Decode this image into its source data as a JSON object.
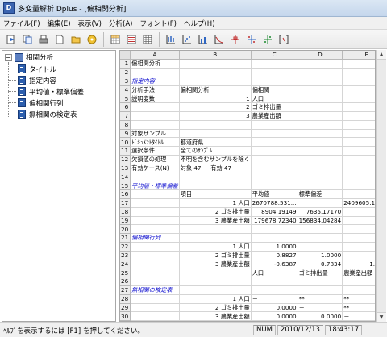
{
  "window": {
    "title": "多変量解析 Dplus - [偏相関分析]",
    "icon_label": "D"
  },
  "menu": [
    {
      "label": "ファイル(F)"
    },
    {
      "label": "編集(E)"
    },
    {
      "label": "表示(V)"
    },
    {
      "label": "分析(A)"
    },
    {
      "label": "フォント(F)"
    },
    {
      "label": "ヘルプ(H)"
    }
  ],
  "toolbar": {
    "icons": [
      "import-icon",
      "copy-icon",
      "print-icon",
      "new-icon",
      "folder-icon",
      "disk-icon",
      "grid-icon",
      "list-icon",
      "table-icon",
      "regression-icon",
      "scatter-icon",
      "bar-chart-icon",
      "axis-chart-icon",
      "boxplot-icon",
      "dots-icon",
      "tree-icon",
      "bracket-icon"
    ]
  },
  "tree": {
    "root": "相関分析",
    "items": [
      "タイトル",
      "指定内容",
      "平均値・標準偏差",
      "偏相関行列",
      "無相関の検定表"
    ]
  },
  "sheet": {
    "columns": [
      "A",
      "B",
      "C",
      "D",
      "E"
    ],
    "rows": [
      {
        "n": "1",
        "c": [
          "偏相関分析",
          "",
          "",
          "",
          ""
        ]
      },
      {
        "n": "2",
        "c": [
          "",
          "",
          "",
          "",
          ""
        ]
      },
      {
        "n": "3",
        "c": [
          "指定内容",
          "",
          "",
          "",
          ""
        ],
        "section": true
      },
      {
        "n": "4",
        "c": [
          "分析手法",
          "偏相関分析",
          "偏相関",
          "",
          ""
        ]
      },
      {
        "n": "5",
        "c": [
          "説明変数",
          "1",
          "人口",
          "",
          ""
        ]
      },
      {
        "n": "6",
        "c": [
          "",
          "2",
          "ゴミ排出量",
          "",
          ""
        ]
      },
      {
        "n": "7",
        "c": [
          "",
          "3",
          "農業産出額",
          "",
          ""
        ]
      },
      {
        "n": "8",
        "c": [
          "",
          "",
          "",
          "",
          ""
        ]
      },
      {
        "n": "9",
        "c": [
          "対象サンプル",
          "",
          "",
          "",
          ""
        ]
      },
      {
        "n": "10",
        "c": [
          "ﾄﾞｷｭﾒﾝﾄﾀｲﾄﾙ",
          "都道府県",
          "",
          "",
          ""
        ]
      },
      {
        "n": "11",
        "c": [
          "選択条件",
          "全てのｻﾝﾌﾟﾙ",
          "",
          "",
          ""
        ]
      },
      {
        "n": "12",
        "c": [
          "欠損値の処理",
          "不明を含むサンプルを除く",
          "",
          "",
          ""
        ]
      },
      {
        "n": "13",
        "c": [
          "有効ケース(N)",
          "対象 47 － 有効 47",
          "",
          "",
          ""
        ]
      },
      {
        "n": "14",
        "c": [
          "",
          "",
          "",
          "",
          ""
        ]
      },
      {
        "n": "15",
        "c": [
          "平均値・標準偏差",
          "",
          "",
          "",
          ""
        ],
        "section": true
      },
      {
        "n": "16",
        "c": [
          "",
          "項目",
          "平均値",
          "標準偏差",
          ""
        ]
      },
      {
        "n": "17",
        "c": [
          "",
          "1 人口",
          "2670788.531...",
          "",
          "2409605.10560"
        ]
      },
      {
        "n": "18",
        "c": [
          "",
          "2 ゴミ排出量",
          "8904.19149",
          "7635.17170",
          ""
        ]
      },
      {
        "n": "19",
        "c": [
          "",
          "3 農業産出額",
          "179678.72340",
          "156834.04284",
          ""
        ]
      },
      {
        "n": "20",
        "c": [
          "",
          "",
          "",
          "",
          ""
        ]
      },
      {
        "n": "21",
        "c": [
          "偏相関行列",
          "",
          "",
          "",
          ""
        ],
        "section": true
      },
      {
        "n": "22",
        "c": [
          "",
          "1 人口",
          "1.0000",
          "",
          ""
        ]
      },
      {
        "n": "23",
        "c": [
          "",
          "2 ゴミ排出量",
          "0.8827",
          "1.0000",
          ""
        ]
      },
      {
        "n": "24",
        "c": [
          "",
          "3 農業産出額",
          "-0.6387",
          "0.7834",
          "1.0000"
        ]
      },
      {
        "n": "25",
        "c": [
          "",
          "",
          "人口",
          "ゴミ排出量",
          "農業産出額"
        ]
      },
      {
        "n": "26",
        "c": [
          "",
          "",
          "",
          "",
          ""
        ]
      },
      {
        "n": "27",
        "c": [
          "無相関の検定表",
          "",
          "",
          "",
          ""
        ],
        "section": true
      },
      {
        "n": "28",
        "c": [
          "",
          "1 人口",
          "－",
          "**",
          "**"
        ]
      },
      {
        "n": "29",
        "c": [
          "",
          "2 ゴミ排出量",
          "0.0000",
          "－",
          "**"
        ]
      },
      {
        "n": "30",
        "c": [
          "",
          "3 農業産出額",
          "0.0000",
          "0.0000",
          "－"
        ]
      },
      {
        "n": "31",
        "c": [
          "",
          "",
          "人口",
          "ゴミ排出量",
          "農業産出額"
        ]
      },
      {
        "n": "32",
        "c": [
          "",
          "",
          "",
          "",
          ""
        ]
      }
    ]
  },
  "status": {
    "message": "ﾍﾙﾌﾟを表示するには [F1] を押してください。",
    "num": "NUM",
    "date": "2010/12/13",
    "time": "18:43:17"
  }
}
